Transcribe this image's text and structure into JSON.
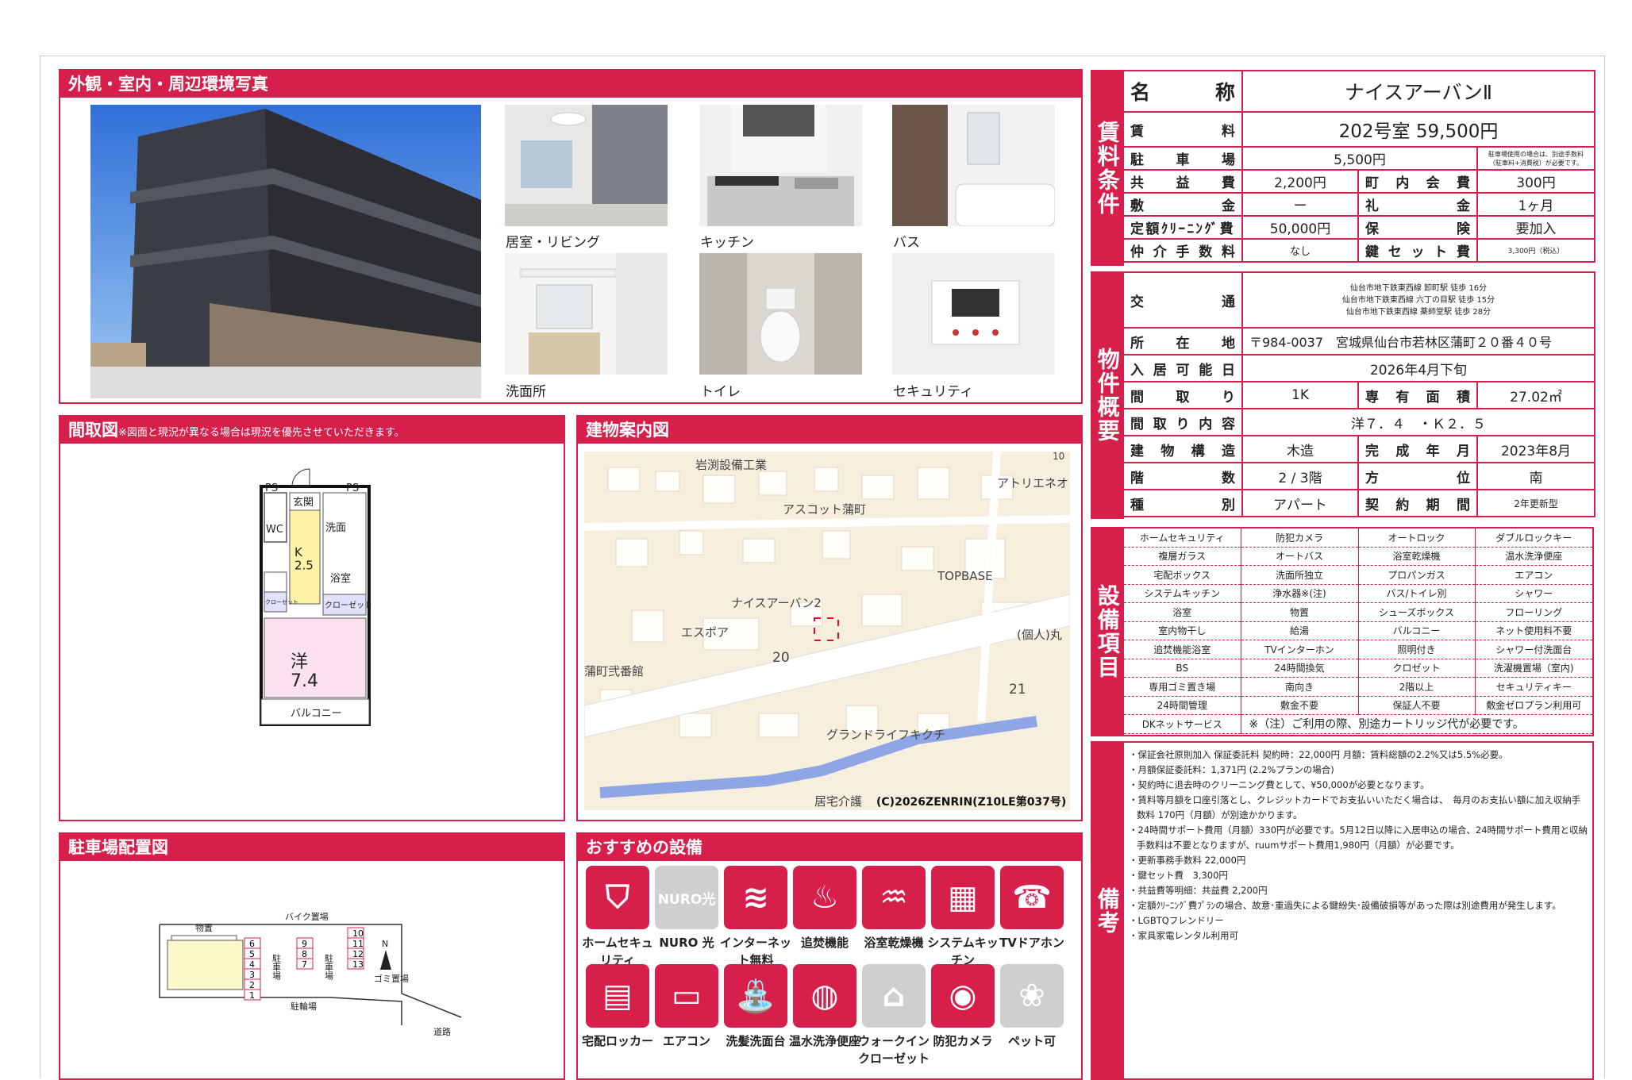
{
  "photos_panel": {
    "title": "外観・室内・周辺環境写真",
    "labels": [
      "居室・リビング",
      "キッチン",
      "バス",
      "洗面所",
      "トイレ",
      "セキュリティ"
    ]
  },
  "floor_panel": {
    "title": "間取図",
    "note": "※図面と現況が異なる場合は現況を優先させていただきます。",
    "rooms": {
      "ps1": "PS",
      "ps2": "PS",
      "entrance": "玄関",
      "wc": "WC",
      "wash": "洗面",
      "kitchen": "K\n2.5",
      "bath": "浴室",
      "closet1": "クローゼット",
      "closet2": "クローゼット",
      "western": "洋\n7.4",
      "balcony": "バルコニー"
    }
  },
  "map_panel": {
    "title": "建物案内図",
    "places": [
      "岩渕設備工業",
      "アトリエネオ",
      "アスコット蒲町",
      "TOPBASE",
      "ナイスアーバン2",
      "エスポア",
      "(個人)丸",
      "蒲町弐番館",
      "グランドライフキクチ",
      "居宅介護"
    ],
    "numbers": [
      "20",
      "21",
      "10"
    ],
    "copyright": "(C)2026ZENRIN(Z10LE第037号)"
  },
  "parking_panel": {
    "title": "駐車場配置図",
    "labels": {
      "storage": "物置",
      "bike": "バイク置場",
      "parking_a": "駐車場",
      "parking_b": "駐車場",
      "garbage": "ゴミ置場",
      "bicycle": "駐輪場",
      "road": "道路",
      "north": "N"
    },
    "col1": [
      "6",
      "5",
      "4",
      "3",
      "2",
      "1"
    ],
    "col2": [
      "9",
      "8",
      "7"
    ],
    "col3": [
      "10",
      "11",
      "12",
      "13"
    ]
  },
  "features_panel": {
    "title": "おすすめの設備",
    "row1": [
      {
        "label": "ホームセキュリティ",
        "icon": "shield-icon"
      },
      {
        "label": "NURO 光",
        "icon": "nuro-icon"
      },
      {
        "label": "インターネット無料",
        "icon": "wifi-icon"
      },
      {
        "label": "追焚機能",
        "icon": "bathtub-icon"
      },
      {
        "label": "浴室乾燥機",
        "icon": "bath-dryer-icon"
      },
      {
        "label": "システムキッチン",
        "icon": "kitchen-icon"
      },
      {
        "label": "TVドアホン",
        "icon": "intercom-icon"
      }
    ],
    "row2": [
      {
        "label": "宅配ロッカー",
        "icon": "locker-icon"
      },
      {
        "label": "エアコン",
        "icon": "aircon-icon"
      },
      {
        "label": "洗髪洗面台",
        "icon": "washbasin-icon"
      },
      {
        "label": "温水洗浄便座",
        "icon": "toilet-icon"
      },
      {
        "label": "ウォークインクローゼット",
        "icon": "closet-icon"
      },
      {
        "label": "防犯カメラ",
        "icon": "camera-icon"
      },
      {
        "label": "ペット可",
        "icon": "paw-icon"
      }
    ],
    "nuro_text": "NURO光"
  },
  "rent": {
    "side": "賃料条件",
    "name_label": "名称",
    "name": "ナイスアーバンⅡ",
    "rent_label": "賃料",
    "rent": "202号室 59,500円",
    "parking_label": "駐車場",
    "parking": "5,500円",
    "parking_note": "駐車場使用の場合は、別途手数料（駐車料+消費税）が必要です。",
    "common_label": "共益費",
    "common": "2,200円",
    "town_label": "町内会費",
    "town": "300円",
    "deposit_label": "敷金",
    "deposit": "ー",
    "key_money_label": "礼金",
    "key_money": "1ヶ月",
    "cleaning_label": "定額ｸﾘｰﾆﾝｸﾞ費",
    "cleaning": "50,000円",
    "insurance_label": "保険",
    "insurance": "要加入",
    "brokerage_label": "仲介手数料",
    "brokerage": "なし",
    "key_label": "鍵セット費",
    "key": "3,300円（税込）"
  },
  "property": {
    "side": "物件概要",
    "transport_label": "交通",
    "transport": [
      "仙台市地下鉄東西線 卸町駅 徒歩 16分",
      "仙台市地下鉄東西線 六丁の目駅 徒歩 15分",
      "仙台市地下鉄東西線 薬師堂駅 徒歩 28分"
    ],
    "address_label": "所在地",
    "address": "〒984-0037　宮城県仙台市若林区蒲町２０番４０号",
    "movein_label": "入居可能日",
    "movein": "2026年4月下旬",
    "layout_label": "間取り",
    "layout": "1K",
    "area_label": "専有面積",
    "area": "27.02㎡",
    "layout_detail_label": "間取り内容",
    "layout_detail": "洋７．４　・Ｋ２．５",
    "structure_label": "建物構造",
    "structure": "木造",
    "built_label": "完成年月",
    "built": "2023年8月",
    "floors_label": "階数",
    "floors": "2 / 3階",
    "direction_label": "方位",
    "direction": "南",
    "type_label": "種別",
    "type": "アパート",
    "contract_label": "契約期間",
    "contract": "2年更新型"
  },
  "equipment": {
    "side": "設備項目",
    "rows": [
      [
        "ホームセキュリティ",
        "防犯カメラ",
        "オートロック",
        "ダブルロックキー"
      ],
      [
        "複層ガラス",
        "オートバス",
        "浴室乾燥機",
        "温水洗浄便座"
      ],
      [
        "宅配ボックス",
        "洗面所独立",
        "プロパンガス",
        "エアコン"
      ],
      [
        "システムキッチン",
        "浄水器※(注)",
        "バス/トイレ別",
        "シャワー"
      ],
      [
        "浴室",
        "物置",
        "シューズボックス",
        "フローリング"
      ],
      [
        "室内物干し",
        "給湯",
        "バルコニー",
        "ネット使用料不要"
      ],
      [
        "追焚機能浴室",
        "TVインターホン",
        "照明付き",
        "シャワー付洗面台"
      ],
      [
        "BS",
        "24時間換気",
        "クロゼット",
        "洗濯機置場（室内)"
      ],
      [
        "専用ゴミ置き場",
        "南向き",
        "2階以上",
        "セキュリティキー"
      ],
      [
        "24時間管理",
        "敷金不要",
        "保証人不要",
        "敷金ゼロプラン利用可"
      ]
    ],
    "last_item": "DKネットサービス",
    "last_note": "※（注）ご利用の際、別途カートリッジ代が必要です。"
  },
  "remarks": {
    "side": "備考",
    "items": [
      "・保証会社原則加入 保証委託料 契約時：22,000円 月額：賃料総額の2.2%又は5.5%必要。",
      "・月額保証委託料：1,371円 (2.2%プランの場合)",
      "・契約時に退去時のクリーニング費として、¥50,000が必要となります。",
      "・賃料等月額を口座引落とし、クレジットカードでお支払いいただく場合は、　毎月のお支払い額に加え収納手数料 170円（月額）が別途かかります。",
      "・24時間サポート費用（月額）330円が必要です。5月12日以降に入居申込の場合、24時間サポート費用と収納手数料は不要となりますが、ruumサポート費用1,980円（月額）が必要です。",
      "・更新事務手数料 22,000円",
      "・鍵セット費　3,300円",
      "・共益費等明細：共益費 2,200円",
      "・定額ｸﾘｰﾆﾝｸﾞ費ﾌﾟﾗﾝの場合、故意･重過失による鍵紛失･設備破損等があった際は別途費用が発生します。",
      "・LGBTQフレンドリー",
      "・家具家電レンタル利用可"
    ]
  }
}
